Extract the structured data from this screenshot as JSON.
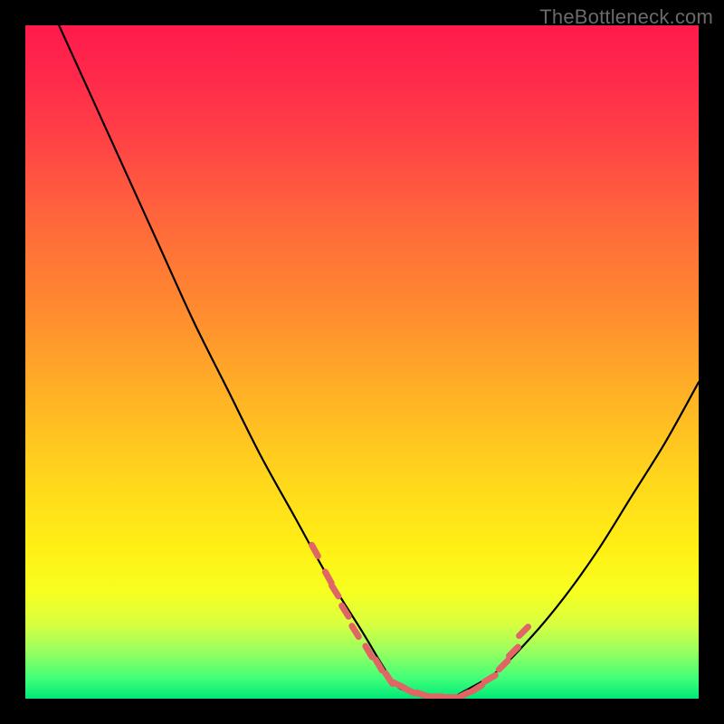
{
  "watermark": "TheBottleneck.com",
  "chart_data": {
    "type": "line",
    "title": "",
    "xlabel": "",
    "ylabel": "",
    "xlim": [
      0,
      100
    ],
    "ylim": [
      0,
      100
    ],
    "grid": false,
    "legend": false,
    "series": [
      {
        "name": "bottleneck-curve",
        "x": [
          5,
          10,
          15,
          20,
          25,
          30,
          35,
          40,
          45,
          50,
          53,
          55,
          57,
          60,
          63,
          65,
          70,
          75,
          80,
          85,
          90,
          95,
          100
        ],
        "y": [
          100,
          89,
          78,
          67,
          56,
          46,
          36,
          27,
          18,
          10,
          5,
          2,
          1,
          0,
          0,
          1,
          4,
          9,
          15,
          22,
          30,
          38,
          47
        ]
      }
    ],
    "markers": {
      "name": "highlight-dashes",
      "x": [
        43,
        45,
        46,
        47.5,
        49,
        51,
        52.5,
        54,
        55.5,
        57,
        59,
        61,
        63,
        65,
        67,
        69,
        71,
        72.5,
        74
      ],
      "y": [
        22,
        18,
        16,
        13,
        10,
        7,
        5,
        3,
        2,
        1.2,
        0.6,
        0.3,
        0.2,
        0.5,
        1.5,
        3,
        5,
        7,
        10
      ]
    },
    "background_gradient": {
      "top": "#ff1a4d",
      "middle": "#ffd81c",
      "bottom": "#00e878"
    }
  }
}
